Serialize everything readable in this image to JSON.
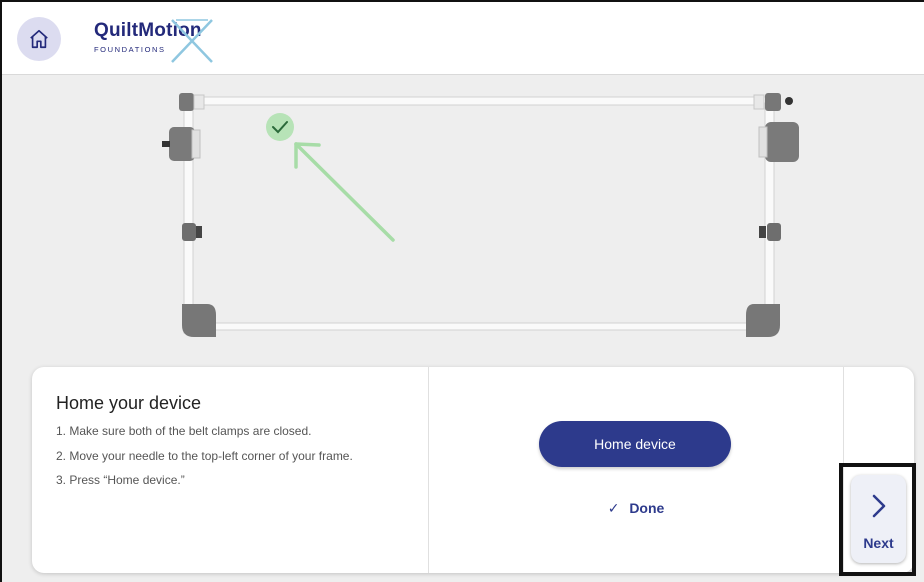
{
  "header": {
    "home_icon": "home-icon",
    "logo_main": "QuiltMotion",
    "logo_sub": "FOUNDATIONS",
    "brand_color": "#23297a"
  },
  "illustration": {
    "check_icon": "check-icon",
    "arrow_color": "#a7dca7"
  },
  "instructions": {
    "title": "Home your device",
    "steps": [
      "1. Make sure both of the belt clamps are closed.",
      "2. Move your needle to the top-left corner of your frame.",
      "3. Press “Home device.”"
    ]
  },
  "actions": {
    "home_device_label": "Home device",
    "done_mark": "✓",
    "done_label": "Done",
    "button_color": "#2d3a8c"
  },
  "nav": {
    "next_icon": "chevron-right-icon",
    "next_label": "Next"
  }
}
